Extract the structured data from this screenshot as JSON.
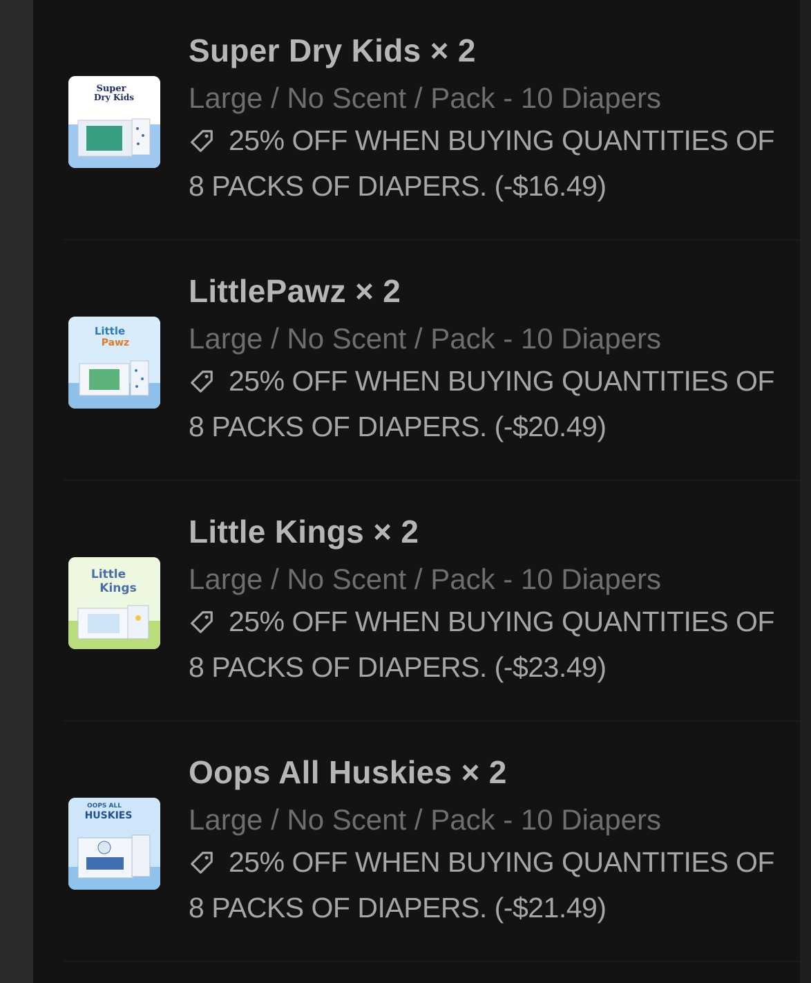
{
  "cart": {
    "items": [
      {
        "title": "Super Dry Kids × 2",
        "variant": "Large / No Scent / Pack - 10 Diapers",
        "discount_line": "25% OFF WHEN BUYING QUANTITIES OF 8 PACKS OF DIAPERS. (-$16.49)",
        "thumb_text": [
          "Super",
          "Dry Kids"
        ],
        "thumb_bg": "#9fc8f0",
        "icon": "tag-icon"
      },
      {
        "title": "LittlePawz × 2",
        "variant": "Large / No Scent / Pack - 10 Diapers",
        "discount_line": "25% OFF WHEN BUYING QUANTITIES OF 8 PACKS OF DIAPERS. (-$20.49)",
        "thumb_text": [
          "Little",
          "Pawz"
        ],
        "thumb_bg": "#8ec0ea",
        "icon": "tag-icon"
      },
      {
        "title": "Little Kings × 2",
        "variant": "Large / No Scent / Pack - 10 Diapers",
        "discount_line": "25% OFF WHEN BUYING QUANTITIES OF 8 PACKS OF DIAPERS. (-$23.49)",
        "thumb_text": [
          "Little",
          "Kings"
        ],
        "thumb_bg": "#b9dd7a",
        "icon": "tag-icon"
      },
      {
        "title": "Oops All Huskies × 2",
        "variant": "Large / No Scent / Pack - 10 Diapers",
        "discount_line": "25% OFF WHEN BUYING QUANTITIES OF 8 PACKS OF DIAPERS. (-$21.49)",
        "thumb_text": [
          "OOPS ALL",
          "HUSKIES"
        ],
        "thumb_bg": "#8fc2ec",
        "icon": "tag-icon"
      }
    ]
  },
  "colors": {
    "panel_bg": "#131313",
    "title_text": "#b6b6b6",
    "variant_text": "#6e6e6e",
    "discount_text": "#a6a6a6"
  }
}
